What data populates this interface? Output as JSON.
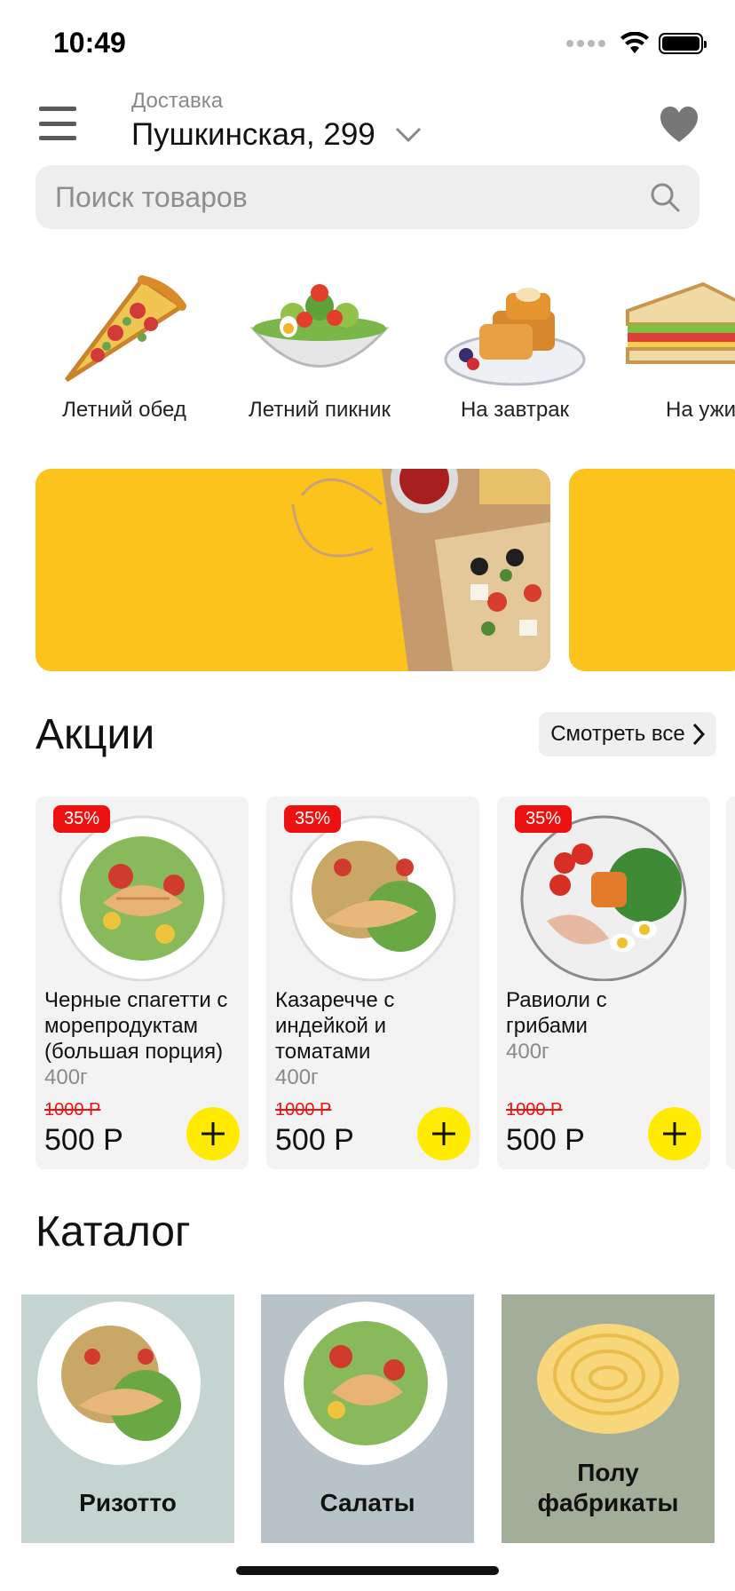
{
  "status": {
    "time": "10:49"
  },
  "header": {
    "delivery_label": "Доставка",
    "address": "Пушкинская, 299"
  },
  "search": {
    "placeholder": "Поиск товаров"
  },
  "stories": [
    {
      "label": "Летний обед",
      "icon": "pizza-icon"
    },
    {
      "label": "Летний пикник",
      "icon": "salad-icon"
    },
    {
      "label": "На завтрак",
      "icon": "waffles-icon"
    },
    {
      "label": "На ужин",
      "icon": "sandwich-icon"
    }
  ],
  "promo": {
    "title": "Акции",
    "see_all": "Смотреть все",
    "items": [
      {
        "badge": "35%",
        "name": "Черные спагетти с морепродуктам (большая порция)",
        "weight": "400г",
        "old_price": "1000 Р",
        "price": "500 Р"
      },
      {
        "badge": "35%",
        "name": "Казаречче с индейкой и томатами",
        "weight": "400г",
        "old_price": "1000 Р",
        "price": "500 Р"
      },
      {
        "badge": "35%",
        "name": "Равиоли с грибами",
        "weight": "400г",
        "old_price": "1000 Р",
        "price": "500 Р"
      }
    ]
  },
  "catalog": {
    "title": "Каталог",
    "items": [
      {
        "label": "Ризотто",
        "bg": "#c5d4d0"
      },
      {
        "label": "Салаты",
        "bg": "#b7c3c8"
      },
      {
        "label": "Полу фабрикаты",
        "bg": "#a2ad9a"
      }
    ]
  },
  "colors": {
    "accent": "#ffeb00",
    "banner": "#fbc31b",
    "discount": "#ee1111"
  }
}
